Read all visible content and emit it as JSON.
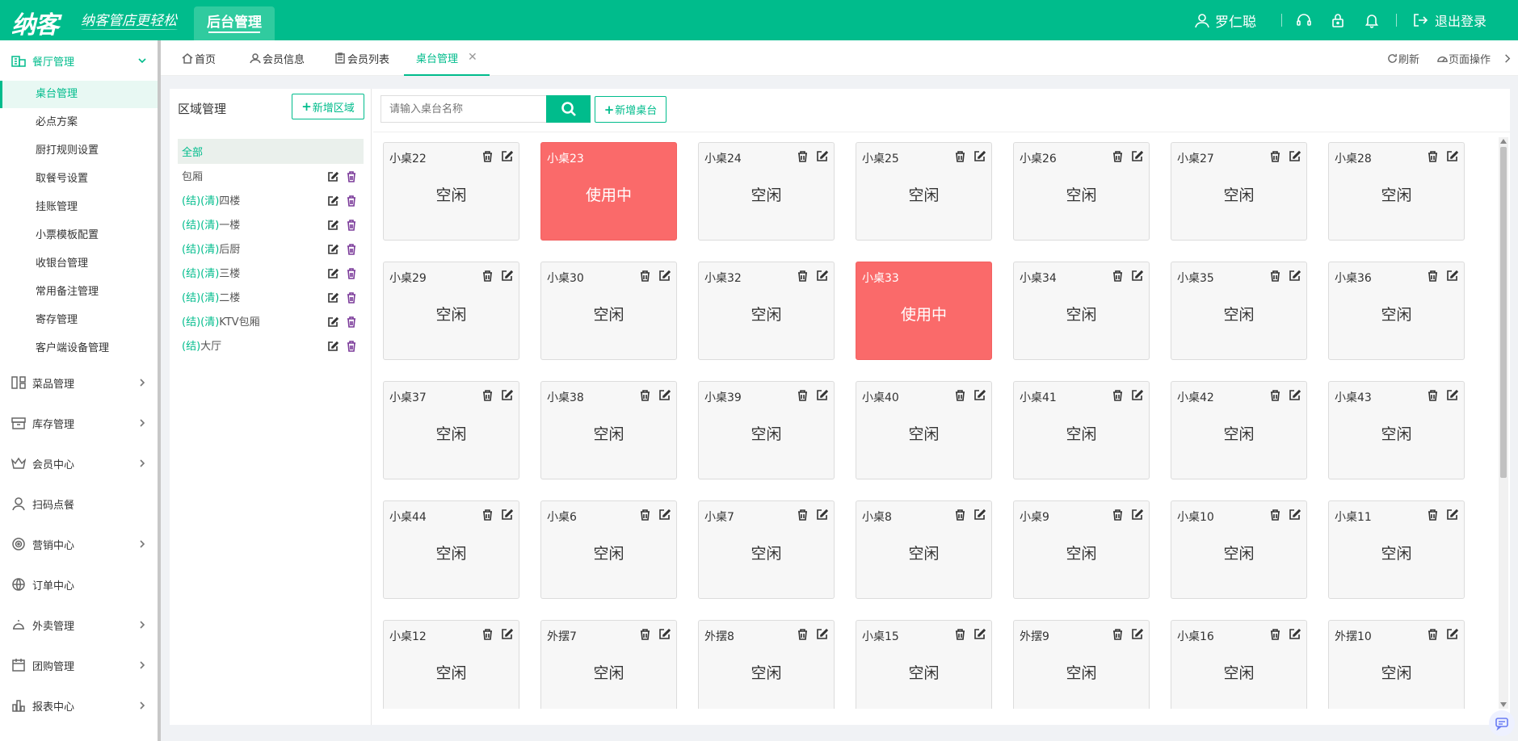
{
  "header": {
    "logo": "纳客",
    "slogan": "纳客管店更轻松",
    "active_tab": "后台管理",
    "user_name": "罗仁聪",
    "logout": "退出登录"
  },
  "sidebar": {
    "groups": [
      {
        "label": "餐厅管理",
        "icon": "restaurant-icon"
      },
      {
        "label": "菜品管理",
        "icon": "dishes-icon"
      },
      {
        "label": "库存管理",
        "icon": "inventory-icon"
      },
      {
        "label": "会员中心",
        "icon": "crown-icon"
      },
      {
        "label": "扫码点餐",
        "icon": "user-icon"
      },
      {
        "label": "营销中心",
        "icon": "target-icon"
      },
      {
        "label": "订单中心",
        "icon": "globe-icon"
      },
      {
        "label": "外卖管理",
        "icon": "takeout-icon"
      },
      {
        "label": "团购管理",
        "icon": "calendar-icon"
      },
      {
        "label": "报表中心",
        "icon": "report-icon"
      }
    ],
    "sub_items": [
      "桌台管理",
      "必点方案",
      "厨打规则设置",
      "取餐号设置",
      "挂账管理",
      "小票模板配置",
      "收银台管理",
      "常用备注管理",
      "寄存管理",
      "客户端设备管理"
    ]
  },
  "tabs": [
    {
      "label": "首页"
    },
    {
      "label": "会员信息"
    },
    {
      "label": "会员列表"
    },
    {
      "label": "桌台管理"
    }
  ],
  "tab_actions": {
    "refresh": "刷新",
    "page_ops": "页面操作"
  },
  "area": {
    "title": "区域管理",
    "add_button": "新增区域",
    "items": [
      {
        "label": "全部",
        "prefix": ""
      },
      {
        "label": "包厢",
        "prefix": ""
      },
      {
        "label": "四楼",
        "prefix": "(结)(清)"
      },
      {
        "label": "一楼",
        "prefix": "(结)(清)"
      },
      {
        "label": "后厨",
        "prefix": "(结)(清)"
      },
      {
        "label": "三楼",
        "prefix": "(结)(清)"
      },
      {
        "label": "二楼",
        "prefix": "(结)(清)"
      },
      {
        "label": "KTV包厢",
        "prefix": "(结)(清)"
      },
      {
        "label": "大厅",
        "prefix": "(结)"
      }
    ]
  },
  "search": {
    "placeholder": "请输入桌台名称",
    "add_table_button": "新增桌台"
  },
  "tables": [
    {
      "name": "小桌22",
      "status": "空闲",
      "busy": false
    },
    {
      "name": "小桌23",
      "status": "使用中",
      "busy": true
    },
    {
      "name": "小桌24",
      "status": "空闲",
      "busy": false
    },
    {
      "name": "小桌25",
      "status": "空闲",
      "busy": false
    },
    {
      "name": "小桌26",
      "status": "空闲",
      "busy": false
    },
    {
      "name": "小桌27",
      "status": "空闲",
      "busy": false
    },
    {
      "name": "小桌28",
      "status": "空闲",
      "busy": false
    },
    {
      "name": "小桌29",
      "status": "空闲",
      "busy": false
    },
    {
      "name": "小桌30",
      "status": "空闲",
      "busy": false
    },
    {
      "name": "小桌32",
      "status": "空闲",
      "busy": false
    },
    {
      "name": "小桌33",
      "status": "使用中",
      "busy": true
    },
    {
      "name": "小桌34",
      "status": "空闲",
      "busy": false
    },
    {
      "name": "小桌35",
      "status": "空闲",
      "busy": false
    },
    {
      "name": "小桌36",
      "status": "空闲",
      "busy": false
    },
    {
      "name": "小桌37",
      "status": "空闲",
      "busy": false
    },
    {
      "name": "小桌38",
      "status": "空闲",
      "busy": false
    },
    {
      "name": "小桌39",
      "status": "空闲",
      "busy": false
    },
    {
      "name": "小桌40",
      "status": "空闲",
      "busy": false
    },
    {
      "name": "小桌41",
      "status": "空闲",
      "busy": false
    },
    {
      "name": "小桌42",
      "status": "空闲",
      "busy": false
    },
    {
      "name": "小桌43",
      "status": "空闲",
      "busy": false
    },
    {
      "name": "小桌44",
      "status": "空闲",
      "busy": false
    },
    {
      "name": "小桌6",
      "status": "空闲",
      "busy": false
    },
    {
      "name": "小桌7",
      "status": "空闲",
      "busy": false
    },
    {
      "name": "小桌8",
      "status": "空闲",
      "busy": false
    },
    {
      "name": "小桌9",
      "status": "空闲",
      "busy": false
    },
    {
      "name": "小桌10",
      "status": "空闲",
      "busy": false
    },
    {
      "name": "小桌11",
      "status": "空闲",
      "busy": false
    },
    {
      "name": "小桌12",
      "status": "空闲",
      "busy": false
    },
    {
      "name": "外摆7",
      "status": "空闲",
      "busy": false
    },
    {
      "name": "外摆8",
      "status": "空闲",
      "busy": false
    },
    {
      "name": "小桌15",
      "status": "空闲",
      "busy": false
    },
    {
      "name": "外摆9",
      "status": "空闲",
      "busy": false
    },
    {
      "name": "小桌16",
      "status": "空闲",
      "busy": false
    },
    {
      "name": "外摆10",
      "status": "空闲",
      "busy": false
    }
  ],
  "colors": {
    "brand": "#00bc8c",
    "busy": "#fa6a6a",
    "delete_icon": "#7b3b9a"
  }
}
